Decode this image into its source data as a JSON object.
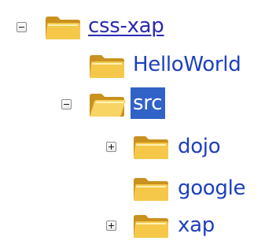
{
  "tree": {
    "nodes": [
      {
        "label": "css-xap",
        "state": "expanded",
        "link": true,
        "selected": false
      },
      {
        "label": "HelloWorld",
        "state": "leaf",
        "link": false,
        "selected": false
      },
      {
        "label": "src",
        "state": "expanded",
        "link": false,
        "selected": true
      },
      {
        "label": "dojo",
        "state": "collapsed",
        "link": false,
        "selected": false
      },
      {
        "label": "google",
        "state": "leaf",
        "link": false,
        "selected": false
      },
      {
        "label": "xap",
        "state": "collapsed",
        "link": false,
        "selected": false
      }
    ]
  },
  "colors": {
    "link": "#2a2ab0",
    "label": "#1d3fbf",
    "selection_bg": "#3162c8",
    "selection_text": "#ffffff",
    "folder_body": "#f5c84a",
    "folder_shadow": "#c9911d"
  },
  "icons": {
    "folder": "folder-icon",
    "expand": "expand-plus-icon",
    "collapse": "collapse-minus-icon"
  }
}
